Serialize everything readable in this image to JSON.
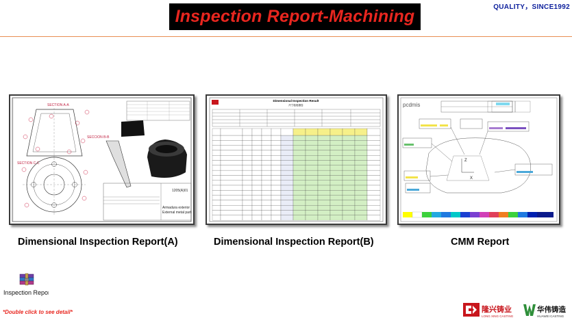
{
  "header": {
    "title": "Inspection Report-Machining",
    "slogan": "QUALITY，SINCE1992"
  },
  "reports": [
    {
      "caption": "Dimensional Inspection Report(A)"
    },
    {
      "caption": "Dimensional Inspection Report(B)"
    },
    {
      "caption": "CMM Report"
    }
  ],
  "thumb_a": {
    "section_a": "SECTION A-A",
    "section_b": "SECCION B-B",
    "section_c": "SECTION C-C",
    "part_desc_1": "Armadura exterior",
    "part_desc_2": "External metal part",
    "drawing_no": "1205(A)01"
  },
  "thumb_b": {
    "heading": "Dimensional Inspection Result",
    "subheading": "尺寸检验报告"
  },
  "thumb_c": {
    "brand": "pcdmis",
    "axis_x": "X",
    "axis_z": "Z"
  },
  "attachment": {
    "icon": "winrar-archive-icon",
    "filename": "Inspection Report-Machining",
    "hint": "*Double click to see detail*"
  },
  "logos": {
    "longxing_cn": "隆兴铸业",
    "longxing_en": "LONG XING CASTING",
    "huawei_cn": "华伟铸造",
    "huawei_en": "HUAWEI CASTING"
  },
  "colors": {
    "title_red": "#e8261f",
    "slogan_blue": "#0c1f9c",
    "rule_orange": "#e98e52",
    "logo_red": "#c8161d",
    "logo_green": "#2f8f3a"
  }
}
